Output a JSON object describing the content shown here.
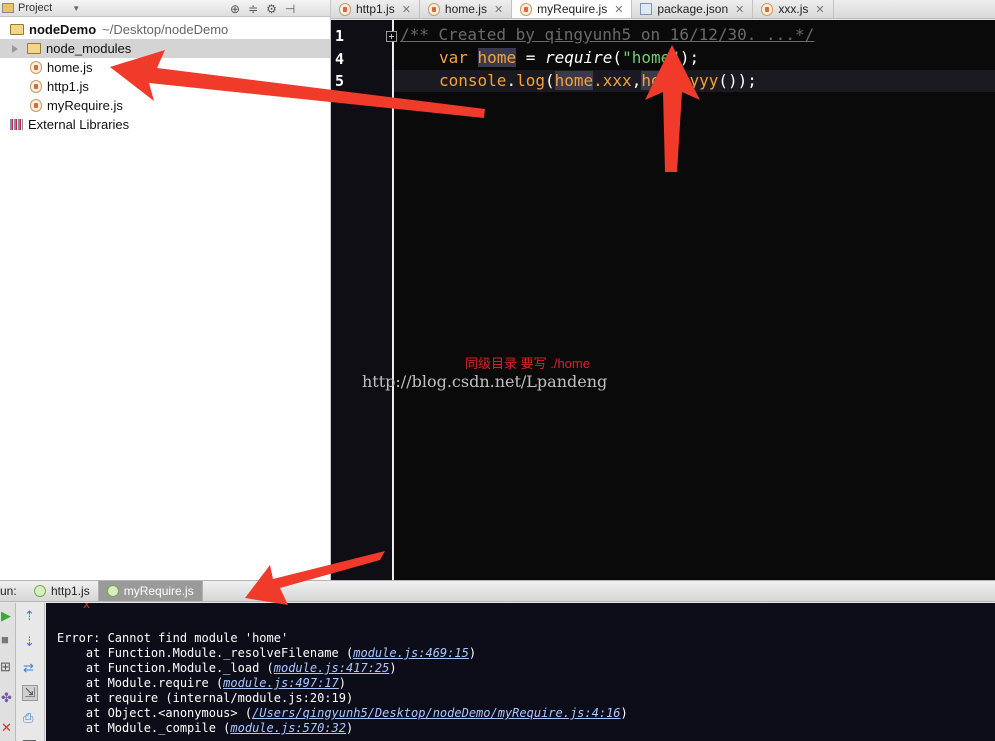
{
  "project": {
    "header_label": "Project",
    "tree": {
      "root_name": "nodeDemo",
      "root_path": "~/Desktop/nodeDemo",
      "items": [
        "node_modules",
        "home.js",
        "http1.js",
        "myRequire.js"
      ],
      "external": "External Libraries"
    }
  },
  "editor": {
    "tabs": [
      "http1.js",
      "home.js",
      "myRequire.js",
      "package.json",
      "xxx.js"
    ],
    "active_tab": "myRequire.js",
    "line_numbers": [
      "1",
      "4",
      "5"
    ],
    "line1_comment": "/** Created by qingyunh5 on 16/12/30. ...*/",
    "line4": {
      "kw": "var",
      "name": "home",
      "eq": " = ",
      "fn": "require",
      "open": "(",
      "str": "\"home\"",
      "close": ");"
    },
    "line5": {
      "console": "console",
      "dot": ".",
      "log": "log",
      "open": "(",
      "obj1": "home",
      "p1": ".xxx",
      "comma": ",",
      "obj2": "home",
      "p2": ".yyy",
      "close": "());"
    }
  },
  "annotations": {
    "note": "同级目录 要写 ./home",
    "watermark": "http://blog.csdn.net/Lpandeng"
  },
  "run": {
    "label": "un:",
    "tabs": [
      "http1.js",
      "myRequire.js"
    ],
    "active_tab": "myRequire.js",
    "console": {
      "marker": "x",
      "error": "Error: Cannot find module 'home'",
      "stack": [
        {
          "pre": "    at Function.Module._resolveFilename (",
          "link": "module.js:469:15",
          "post": ")"
        },
        {
          "pre": "    at Function.Module._load (",
          "link": "module.js:417:25",
          "post": ")"
        },
        {
          "pre": "    at Module.require (",
          "link": "module.js:497:17",
          "post": ")"
        },
        {
          "pre": "    at require (internal/module.js:20:19)",
          "link": "",
          "post": ""
        },
        {
          "pre": "    at Object.<anonymous> (",
          "link": "/Users/qingyunh5/Desktop/nodeDemo/myRequire.js:4:16",
          "post": ")"
        },
        {
          "pre": "    at Module._compile (",
          "link": "module.js:570:32",
          "post": ")"
        }
      ]
    }
  },
  "colors": {
    "arrow": "#f03a2a",
    "keyword": "#f7a13b",
    "string": "#6ed16e",
    "editor_bg": "#0a0a0a",
    "console_bg": "#0d0d1a"
  }
}
